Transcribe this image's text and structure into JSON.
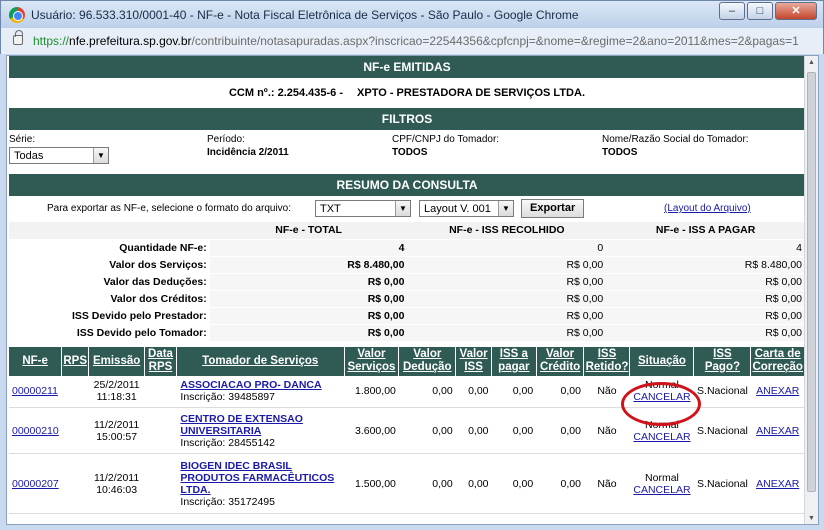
{
  "window": {
    "title": "Usuário: 96.533.310/0001-40 - NF-e - Nota Fiscal Eletrônica de Serviços - São Paulo - Google Chrome",
    "min": "–",
    "max": "□",
    "close": "✕"
  },
  "address": {
    "proto": "https://",
    "host": "nfe.prefeitura.sp.gov.br",
    "path": "/contribuinte/notasapuradas.aspx?inscricao=22544356&cpfcnpj=&nome=&regime=2&ano=2011&mes=2&pagas=1"
  },
  "header": {
    "title": "NF-e EMITIDAS",
    "ccm_label": "CCM nº.: 2.254.435-6 -",
    "company": "XPTO - PRESTADORA DE SERVIÇOS LTDA."
  },
  "filters": {
    "title": "FILTROS",
    "serie_label": "Série:",
    "serie_value": "Todas",
    "periodo_label": "Período:",
    "periodo_value": "Incidência 2/2011",
    "cpf_label": "CPF/CNPJ do Tomador:",
    "cpf_value": "TODOS",
    "nome_label": "Nome/Razão Social do Tomador:",
    "nome_value": "TODOS"
  },
  "resumo": {
    "title": "RESUMO DA CONSULTA",
    "export_label": "Para exportar as NF-e, selecione o formato do arquivo:",
    "format_value": "TXT",
    "layout_value": "Layout V. 001",
    "export_button": "Exportar",
    "layout_link": "(Layout do Arquivo)",
    "columns": [
      "NF-e - TOTAL",
      "NF-e - ISS RECOLHIDO",
      "NF-e - ISS A PAGAR"
    ],
    "rows": [
      {
        "label": "Quantidade NF-e:",
        "total": "4",
        "recolhido": "0",
        "a_pagar": "4"
      },
      {
        "label": "Valor dos Serviços:",
        "total": "R$ 8.480,00",
        "recolhido": "R$ 0,00",
        "a_pagar": "R$ 8.480,00"
      },
      {
        "label": "Valor das Deduções:",
        "total": "R$ 0,00",
        "recolhido": "R$ 0,00",
        "a_pagar": "R$ 0,00"
      },
      {
        "label": "Valor dos Créditos:",
        "total": "R$ 0,00",
        "recolhido": "R$ 0,00",
        "a_pagar": "R$ 0,00"
      },
      {
        "label": "ISS Devido pelo Prestador:",
        "total": "R$ 0,00",
        "recolhido": "R$ 0,00",
        "a_pagar": "R$ 0,00"
      },
      {
        "label": "ISS Devido pelo Tomador:",
        "total": "R$ 0,00",
        "recolhido": "R$ 0,00",
        "a_pagar": "R$ 0,00"
      }
    ]
  },
  "notas": {
    "headers": [
      "NF-e",
      "RPS",
      "Emissão",
      "Data RPS",
      "Tomador de Serviços",
      "Valor Serviços",
      "Valor Dedução",
      "Valor ISS",
      "ISS a pagar",
      "Valor Crédito",
      "ISS Retido?",
      "Situação",
      "ISS Pago?",
      "Carta de Correção"
    ],
    "rows": [
      {
        "nf": "00000211",
        "rps": "",
        "emissao_date": "25/2/2011",
        "emissao_time": "11:18:31",
        "data_rps": "",
        "tomador": "ASSOCIACAO PRO- DANCA",
        "inscricao": "Inscrição: 39485897",
        "valor_servicos": "1.800,00",
        "valor_deducao": "0,00",
        "valor_iss": "0,00",
        "iss_a_pagar": "0,00",
        "valor_credito": "0,00",
        "retido": "Não",
        "situacao": "Normal",
        "cancelar": "CANCELAR",
        "pago": "S.Nacional",
        "carta": "ANEXAR"
      },
      {
        "nf": "00000210",
        "rps": "",
        "emissao_date": "11/2/2011",
        "emissao_time": "15:00:57",
        "data_rps": "",
        "tomador": "CENTRO DE EXTENSAO UNIVERSITARIA",
        "inscricao": "Inscrição: 28455142",
        "valor_servicos": "3.600,00",
        "valor_deducao": "0,00",
        "valor_iss": "0,00",
        "iss_a_pagar": "0,00",
        "valor_credito": "0,00",
        "retido": "Não",
        "situacao": "Normal",
        "cancelar": "CANCELAR",
        "pago": "S.Nacional",
        "carta": "ANEXAR"
      },
      {
        "nf": "00000207",
        "rps": "",
        "emissao_date": "11/2/2011",
        "emissao_time": "10:46:03",
        "data_rps": "",
        "tomador": "BIOGEN IDEC BRASIL PRODUTOS FARMACÊUTICOS LTDA.",
        "inscricao": "Inscrição: 35172495",
        "valor_servicos": "1.500,00",
        "valor_deducao": "0,00",
        "valor_iss": "0,00",
        "iss_a_pagar": "0,00",
        "valor_credito": "0,00",
        "retido": "Não",
        "situacao": "Normal",
        "cancelar": "CANCELAR",
        "pago": "S.Nacional",
        "carta": "ANEXAR"
      }
    ]
  },
  "colors": {
    "header_bg": "#2f5b54",
    "link": "#1a1aaa",
    "highlight_circle": "#d0121b"
  }
}
